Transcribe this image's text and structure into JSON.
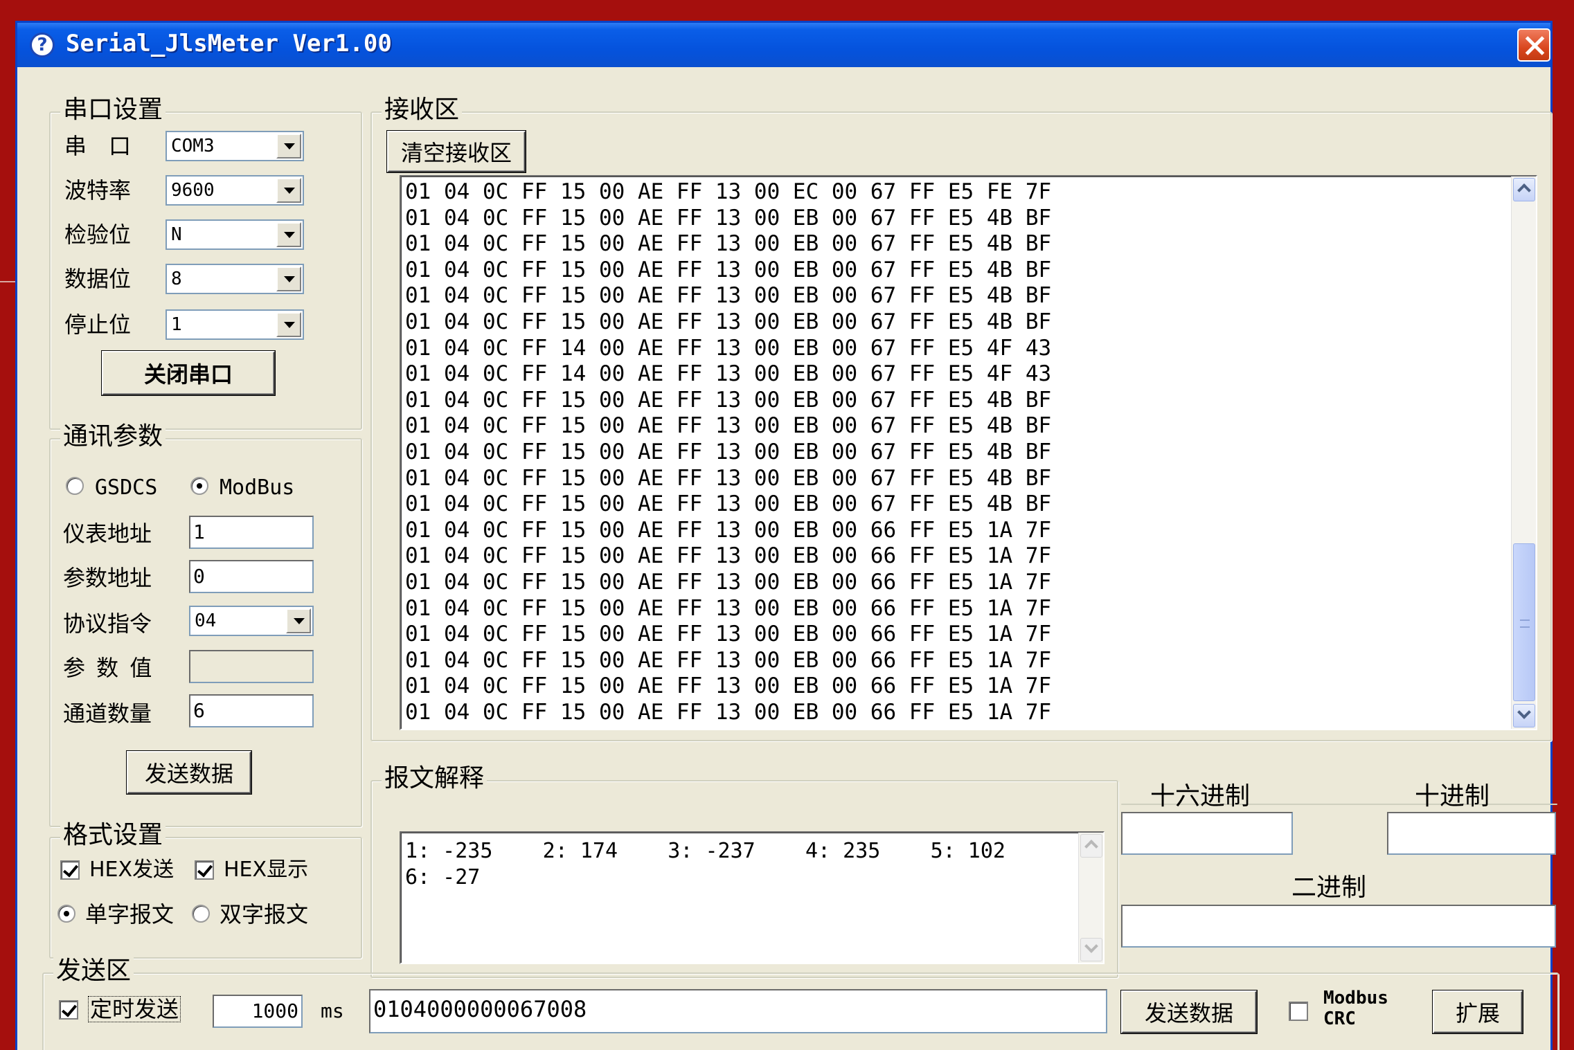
{
  "window": {
    "title": "Serial_JlsMeter Ver1.00"
  },
  "serial": {
    "group_label": "串口设置",
    "port_label": "串　口",
    "port_value": "COM3",
    "baud_label": "波特率",
    "baud_value": "9600",
    "parity_label": "检验位",
    "parity_value": "N",
    "databits_label": "数据位",
    "databits_value": "8",
    "stopbits_label": "停止位",
    "stopbits_value": "1",
    "close_button": "关闭串口"
  },
  "comm": {
    "group_label": "通讯参数",
    "protocol_gsdcs": "GSDCS",
    "protocol_modbus": "ModBus",
    "protocol_selected": "ModBus",
    "meter_addr_label": "仪表地址",
    "meter_addr_value": "1",
    "param_addr_label": "参数地址",
    "param_addr_value": "0",
    "command_label": "协议指令",
    "command_value": "04",
    "param_value_label": "参 数 值",
    "param_value": "",
    "channels_label": "通道数量",
    "channels_value": "6",
    "send_button": "发送数据"
  },
  "format": {
    "group_label": "格式设置",
    "hex_send_label": "HEX发送",
    "hex_send_checked": true,
    "hex_display_label": "HEX显示",
    "hex_display_checked": true,
    "single_word_label": "单字报文",
    "double_word_label": "双字报文",
    "selected": "单字报文"
  },
  "receive": {
    "group_label": "接收区",
    "clear_button": "清空接收区",
    "lines": [
      "01 04 0C FF 15 00 AE FF 13 00 EC 00 67 FF E5 FE 7F",
      "01 04 0C FF 15 00 AE FF 13 00 EB 00 67 FF E5 4B BF",
      "01 04 0C FF 15 00 AE FF 13 00 EB 00 67 FF E5 4B BF",
      "01 04 0C FF 15 00 AE FF 13 00 EB 00 67 FF E5 4B BF",
      "01 04 0C FF 15 00 AE FF 13 00 EB 00 67 FF E5 4B BF",
      "01 04 0C FF 15 00 AE FF 13 00 EB 00 67 FF E5 4B BF",
      "01 04 0C FF 14 00 AE FF 13 00 EB 00 67 FF E5 4F 43",
      "01 04 0C FF 14 00 AE FF 13 00 EB 00 67 FF E5 4F 43",
      "01 04 0C FF 15 00 AE FF 13 00 EB 00 67 FF E5 4B BF",
      "01 04 0C FF 15 00 AE FF 13 00 EB 00 67 FF E5 4B BF",
      "01 04 0C FF 15 00 AE FF 13 00 EB 00 67 FF E5 4B BF",
      "01 04 0C FF 15 00 AE FF 13 00 EB 00 67 FF E5 4B BF",
      "01 04 0C FF 15 00 AE FF 13 00 EB 00 67 FF E5 4B BF",
      "01 04 0C FF 15 00 AE FF 13 00 EB 00 66 FF E5 1A 7F",
      "01 04 0C FF 15 00 AE FF 13 00 EB 00 66 FF E5 1A 7F",
      "01 04 0C FF 15 00 AE FF 13 00 EB 00 66 FF E5 1A 7F",
      "01 04 0C FF 15 00 AE FF 13 00 EB 00 66 FF E5 1A 7F",
      "01 04 0C FF 15 00 AE FF 13 00 EB 00 66 FF E5 1A 7F",
      "01 04 0C FF 15 00 AE FF 13 00 EB 00 66 FF E5 1A 7F",
      "01 04 0C FF 15 00 AE FF 13 00 EB 00 66 FF E5 1A 7F",
      "01 04 0C FF 15 00 AE FF 13 00 EB 00 66 FF E5 1A 7F"
    ]
  },
  "message": {
    "group_label": "报文解释",
    "text": "1: -235    2: 174    3: -237    4: 235    5: 102    6: -27"
  },
  "convert": {
    "hex_label": "十六进制",
    "hex_value": "",
    "dec_label": "十进制",
    "dec_value": "",
    "bin_label": "二进制",
    "bin_value": ""
  },
  "send": {
    "group_label": "发送区",
    "timed_label": "定时发送",
    "timed_checked": true,
    "interval_value": "1000",
    "interval_unit": "ms",
    "data_value": "0104000000067008",
    "send_button": "发送数据",
    "crc_label_line1": "Modbus",
    "crc_label_line2": "CRC",
    "crc_checked": false,
    "expand_button": "扩展"
  }
}
